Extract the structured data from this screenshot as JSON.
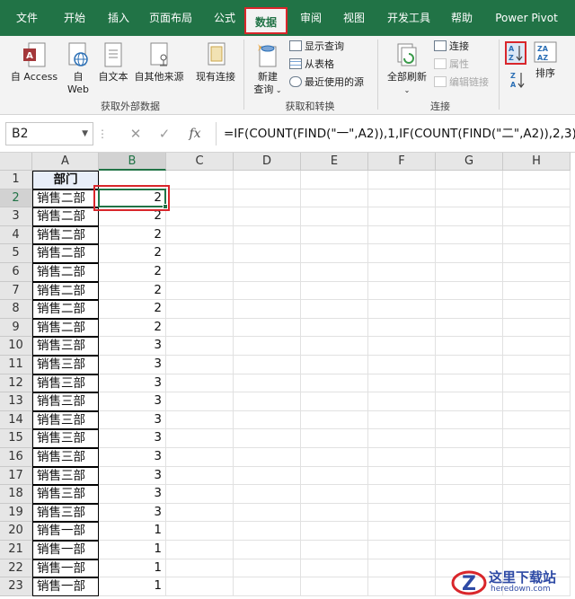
{
  "ribbon_tabs": [
    "文件",
    "开始",
    "插入",
    "页面布局",
    "公式",
    "数据",
    "审阅",
    "视图",
    "开发工具",
    "帮助",
    "Power Pivot"
  ],
  "active_tab": "数据",
  "groups": {
    "get_external": {
      "label": "获取外部数据",
      "access": "自 Access",
      "web_line1": "自",
      "web_line2": "Web",
      "text": "自文本",
      "other": "自其他来源",
      "existing": "现有连接"
    },
    "get_transform": {
      "label": "获取和转换",
      "new_query_line1": "新建",
      "new_query_line2": "查询",
      "show_queries": "显示查询",
      "from_table": "从表格",
      "recent_sources": "最近使用的源"
    },
    "connections": {
      "label": "连接",
      "refresh_all": "全部刷新",
      "connections": "连接",
      "properties": "属性",
      "edit_links": "编辑链接"
    },
    "sort": {
      "sort_label": "排序"
    }
  },
  "formula_bar": {
    "name_box": "B2",
    "cancel_symbol": "✕",
    "enter_symbol": "✓",
    "fx_label": "fx",
    "formula": "=IF(COUNT(FIND(\"一\",A2)),1,IF(COUNT(FIND(\"二\",A2)),2,3))"
  },
  "sheet": {
    "columns": [
      "A",
      "B",
      "C",
      "D",
      "E",
      "F",
      "G",
      "H"
    ],
    "selected_cell": "B2",
    "rows": [
      {
        "n": "1",
        "a": "部门",
        "b": ""
      },
      {
        "n": "2",
        "a": "销售二部",
        "b": "2"
      },
      {
        "n": "3",
        "a": "销售二部",
        "b": "2"
      },
      {
        "n": "4",
        "a": "销售二部",
        "b": "2"
      },
      {
        "n": "5",
        "a": "销售二部",
        "b": "2"
      },
      {
        "n": "6",
        "a": "销售二部",
        "b": "2"
      },
      {
        "n": "7",
        "a": "销售二部",
        "b": "2"
      },
      {
        "n": "8",
        "a": "销售二部",
        "b": "2"
      },
      {
        "n": "9",
        "a": "销售二部",
        "b": "2"
      },
      {
        "n": "10",
        "a": "销售三部",
        "b": "3"
      },
      {
        "n": "11",
        "a": "销售三部",
        "b": "3"
      },
      {
        "n": "12",
        "a": "销售三部",
        "b": "3"
      },
      {
        "n": "13",
        "a": "销售三部",
        "b": "3"
      },
      {
        "n": "14",
        "a": "销售三部",
        "b": "3"
      },
      {
        "n": "15",
        "a": "销售三部",
        "b": "3"
      },
      {
        "n": "16",
        "a": "销售三部",
        "b": "3"
      },
      {
        "n": "17",
        "a": "销售三部",
        "b": "3"
      },
      {
        "n": "18",
        "a": "销售三部",
        "b": "3"
      },
      {
        "n": "19",
        "a": "销售三部",
        "b": "3"
      },
      {
        "n": "20",
        "a": "销售一部",
        "b": "1"
      },
      {
        "n": "21",
        "a": "销售一部",
        "b": "1"
      },
      {
        "n": "22",
        "a": "销售一部",
        "b": "1"
      },
      {
        "n": "23",
        "a": "销售一部",
        "b": "1"
      }
    ]
  },
  "watermark": {
    "name": "这里下载站",
    "url": "heredown.com"
  },
  "colors": {
    "excel_green": "#217346",
    "highlight_red": "#d9262b"
  }
}
